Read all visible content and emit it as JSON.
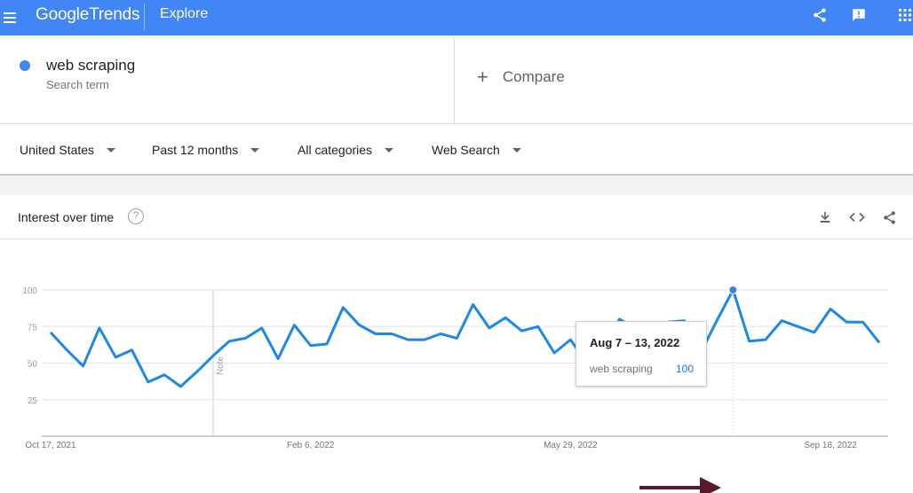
{
  "header": {
    "logo_google": "Google",
    "logo_trends": "Trends",
    "section": "Explore",
    "colors": {
      "bar": "#4285f4"
    },
    "icons": [
      "menu-icon",
      "share-icon",
      "feedback-icon",
      "apps-icon"
    ]
  },
  "search": {
    "term": "web scraping",
    "term_type": "Search term",
    "term_color": "#4285f4",
    "compare_label": "Compare"
  },
  "filters": [
    {
      "label": "United States"
    },
    {
      "label": "Past 12 months"
    },
    {
      "label": "All categories"
    },
    {
      "label": "Web Search"
    }
  ],
  "card": {
    "title": "Interest over time",
    "help": "?",
    "icons": [
      "download-icon",
      "embed-icon",
      "share-icon"
    ]
  },
  "tooltip": {
    "date": "Aug 7 – 13, 2022",
    "term": "web scraping",
    "value": "100"
  },
  "chart_data": {
    "type": "line",
    "title": "",
    "xlabel": "",
    "ylabel": "",
    "ylim": [
      0,
      100
    ],
    "yticks": [
      25,
      50,
      75,
      100
    ],
    "grid": true,
    "x_tick_labels": [
      {
        "label": "Oct 17, 2021",
        "index": 0
      },
      {
        "label": "Feb 6, 2022",
        "index": 16
      },
      {
        "label": "May 29, 2022",
        "index": 32
      },
      {
        "label": "Sep 18, 2022",
        "index": 48
      }
    ],
    "note_label": "Note",
    "note_index": 10,
    "highlight_index": 42,
    "series": [
      {
        "color": "#1e88e5",
        "values": [
          71,
          59,
          48,
          74,
          54,
          59,
          37,
          42,
          34,
          44,
          55,
          65,
          67,
          74,
          53,
          76,
          62,
          63,
          88,
          76,
          70,
          70,
          66,
          66,
          70,
          67,
          90,
          74,
          81,
          72,
          75,
          57,
          66,
          50,
          56,
          80,
          74,
          70,
          78,
          79,
          57,
          79,
          100,
          65,
          66,
          79,
          75,
          71,
          87,
          78,
          78,
          64
        ]
      }
    ]
  }
}
